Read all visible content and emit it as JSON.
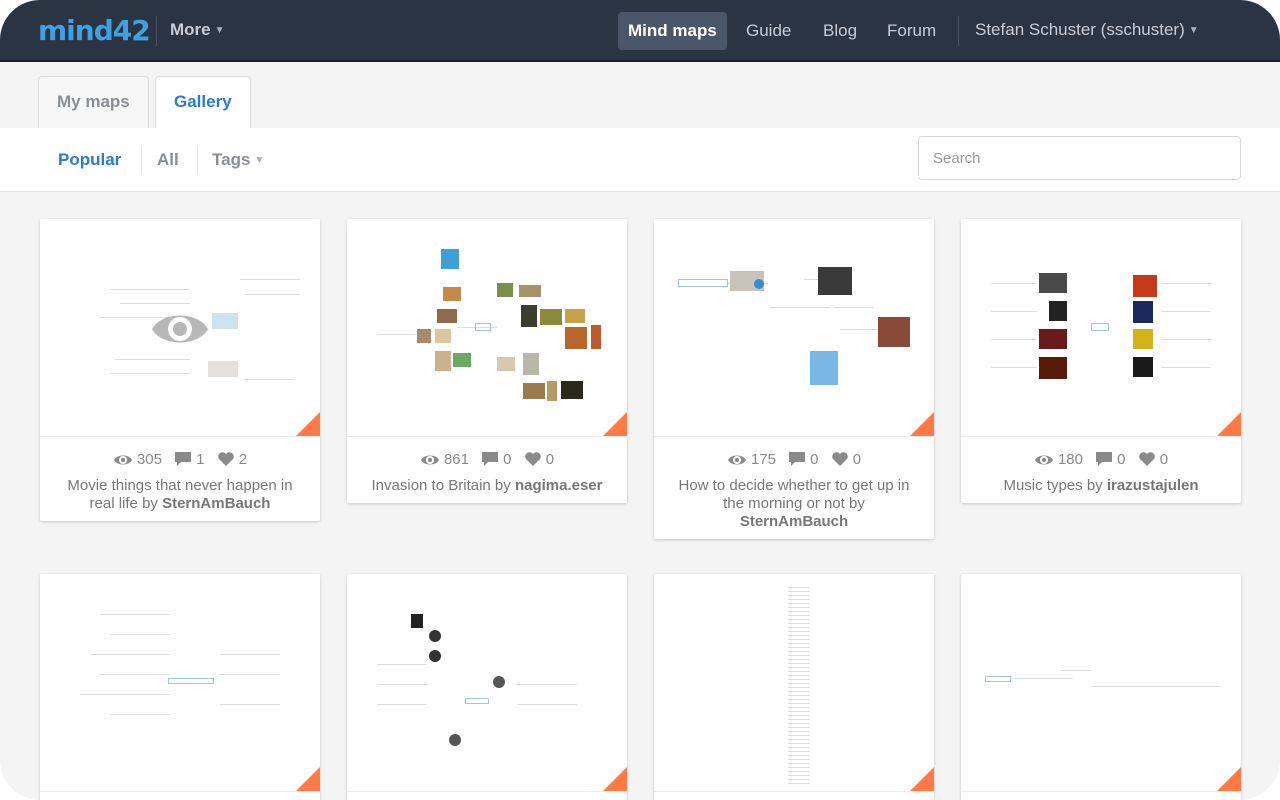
{
  "nav": {
    "logo": "mind42",
    "more": "More",
    "links": [
      "Mind maps",
      "Guide",
      "Blog",
      "Forum"
    ],
    "user": "Stefan Schuster (sschuster)"
  },
  "tabs": [
    "My maps",
    "Gallery"
  ],
  "filters": [
    "Popular",
    "All",
    "Tags"
  ],
  "search": {
    "placeholder": "Search"
  },
  "cards": [
    {
      "views": "305",
      "comments": "1",
      "likes": "2",
      "title": "Movie things that never happen in real life",
      "by": "by",
      "author": "SternAmBauch"
    },
    {
      "views": "861",
      "comments": "0",
      "likes": "0",
      "title": "Invasion to Britain",
      "by": "by",
      "author": "nagima.eser"
    },
    {
      "views": "175",
      "comments": "0",
      "likes": "0",
      "title": "How to decide whether to get up in the morning or not",
      "by": "by",
      "author": "SternAmBauch"
    },
    {
      "views": "180",
      "comments": "0",
      "likes": "0",
      "title": "Music types",
      "by": "by",
      "author": "irazustajulen"
    }
  ],
  "colors": {
    "navbar": "#2b3443",
    "accent": "#2a7ad8",
    "corner": "#ff7a45"
  }
}
